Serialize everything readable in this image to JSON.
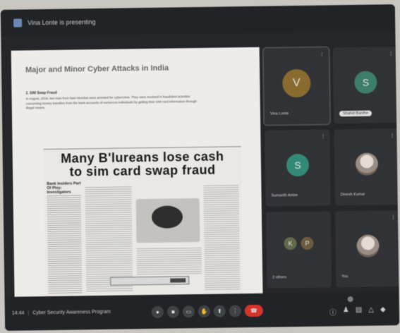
{
  "topbar": {
    "presenting_text": "Vina Lonte is presenting"
  },
  "slide": {
    "title": "Major and Minor Cyber Attacks in India",
    "subtitle": "2. SIM Swap Fraud",
    "body": "In August, 2018, two men from Navi Mumbai were arrested for cybercrime. They were involved in fraudulent activities concerning money transfers from the bank accounts of numerous individuals by getting their SIM card information through illegal means.",
    "clip_headline_1": "Many B'lureans lose cash",
    "clip_headline_2": "to sim card swap fraud",
    "clip_side_head": "Bank Insiders Part Of Ploy: Investigators"
  },
  "participants": [
    {
      "initial": "V",
      "name": "Vina Lonte",
      "color": "#8a6a2b",
      "pill": false
    },
    {
      "initial": "S",
      "name": "Shahid Banthe",
      "color": "#3a7d6b",
      "pill": true
    },
    {
      "initial": "S",
      "name": "Sumanth Ambe",
      "color": "#2f8a74",
      "pill": false
    },
    {
      "initial": "",
      "name": "Dinesh Kumar",
      "color": "",
      "pill": false
    },
    {
      "initial": "K",
      "initial2": "P",
      "name": "2 others",
      "color": "#5e6a4a",
      "color2": "#6b5a3a",
      "pill": false
    },
    {
      "initial": "",
      "name": "You",
      "color": "",
      "pill": false
    }
  ],
  "bottombar": {
    "time": "14:44",
    "meeting_name": "Cyber Security Awareness Program"
  },
  "icons": {
    "mic": "mic-icon",
    "camera": "camera-icon",
    "captions": "captions-icon",
    "raise_hand": "raise-hand-icon",
    "present": "present-icon",
    "more": "more-icon",
    "end_call": "end-call-icon"
  }
}
